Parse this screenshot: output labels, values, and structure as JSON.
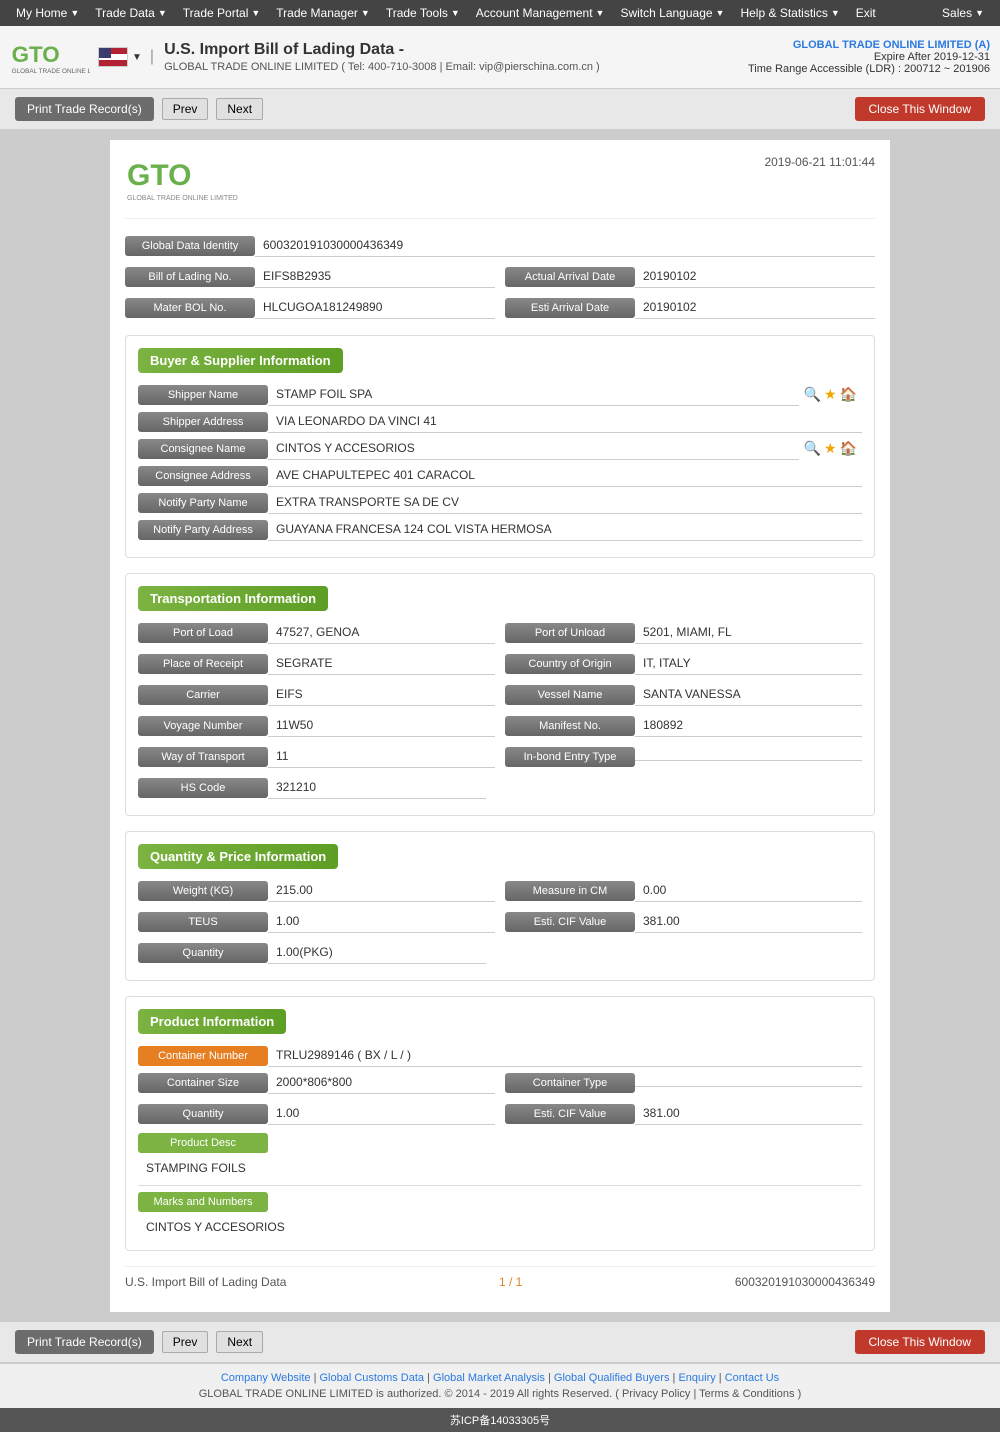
{
  "nav": {
    "items": [
      {
        "label": "My Home",
        "arrow": true
      },
      {
        "label": "Trade Data",
        "arrow": true
      },
      {
        "label": "Trade Portal",
        "arrow": true
      },
      {
        "label": "Trade Manager",
        "arrow": true
      },
      {
        "label": "Trade Tools",
        "arrow": true
      },
      {
        "label": "Account Management",
        "arrow": true
      },
      {
        "label": "Switch Language",
        "arrow": true
      },
      {
        "label": "Help & Statistics",
        "arrow": true
      },
      {
        "label": "Exit",
        "arrow": false
      }
    ],
    "right": "Sales"
  },
  "header": {
    "title": "U.S. Import Bill of Lading Data  -",
    "subtitle": "GLOBAL TRADE ONLINE LIMITED ( Tel: 400-710-3008 | Email: vip@pierschina.com.cn )",
    "company": "GLOBAL TRADE ONLINE LIMITED (A)",
    "expire": "Expire After 2019-12-31",
    "ldr": "Time Range Accessible (LDR) : 200712 ~ 201906"
  },
  "actions": {
    "print_label": "Print Trade Record(s)",
    "prev_label": "Prev",
    "next_label": "Next",
    "close_label": "Close This Window"
  },
  "document": {
    "datetime": "2019-06-21  11:01:44",
    "global_data_identity_label": "Global Data Identity",
    "global_data_identity_value": "600320191030000436349",
    "bill_of_lading_label": "Bill of Lading No.",
    "bill_of_lading_value": "EIFS8B2935",
    "actual_arrival_label": "Actual Arrival Date",
    "actual_arrival_value": "20190102",
    "mater_bol_label": "Mater BOL No.",
    "mater_bol_value": "HLCUGOA181249890",
    "esti_arrival_label": "Esti Arrival Date",
    "esti_arrival_value": "20190102"
  },
  "buyer_supplier": {
    "section_title": "Buyer & Supplier Information",
    "shipper_name_label": "Shipper Name",
    "shipper_name_value": "STAMP FOIL SPA",
    "shipper_address_label": "Shipper Address",
    "shipper_address_value": "VIA LEONARDO DA VINCI 41",
    "consignee_name_label": "Consignee Name",
    "consignee_name_value": "CINTOS Y ACCESORIOS",
    "consignee_address_label": "Consignee Address",
    "consignee_address_value": "AVE CHAPULTEPEC 401 CARACOL",
    "notify_party_name_label": "Notify Party Name",
    "notify_party_name_value": "EXTRA TRANSPORTE SA DE CV",
    "notify_party_address_label": "Notify Party Address",
    "notify_party_address_value": "GUAYANA FRANCESA 124 COL VISTA HERMOSA"
  },
  "transportation": {
    "section_title": "Transportation Information",
    "port_of_load_label": "Port of Load",
    "port_of_load_value": "47527, GENOA",
    "port_of_unload_label": "Port of Unload",
    "port_of_unload_value": "5201, MIAMI, FL",
    "place_of_receipt_label": "Place of Receipt",
    "place_of_receipt_value": "SEGRATE",
    "country_of_origin_label": "Country of Origin",
    "country_of_origin_value": "IT, ITALY",
    "carrier_label": "Carrier",
    "carrier_value": "EIFS",
    "vessel_name_label": "Vessel Name",
    "vessel_name_value": "SANTA VANESSA",
    "voyage_number_label": "Voyage Number",
    "voyage_number_value": "11W50",
    "manifest_no_label": "Manifest No.",
    "manifest_no_value": "180892",
    "way_of_transport_label": "Way of Transport",
    "way_of_transport_value": "11",
    "inbond_entry_label": "In-bond Entry Type",
    "inbond_entry_value": "",
    "hs_code_label": "HS Code",
    "hs_code_value": "321210"
  },
  "quantity_price": {
    "section_title": "Quantity & Price Information",
    "weight_label": "Weight (KG)",
    "weight_value": "215.00",
    "measure_label": "Measure in CM",
    "measure_value": "0.00",
    "teus_label": "TEUS",
    "teus_value": "1.00",
    "esti_cif_label": "Esti. CIF Value",
    "esti_cif_value": "381.00",
    "quantity_label": "Quantity",
    "quantity_value": "1.00(PKG)"
  },
  "product": {
    "section_title": "Product Information",
    "container_number_label": "Container Number",
    "container_number_value": "TRLU2989146 ( BX / L / )",
    "container_size_label": "Container Size",
    "container_size_value": "2000*806*800",
    "container_type_label": "Container Type",
    "container_type_value": "",
    "quantity_label": "Quantity",
    "quantity_value": "1.00",
    "esti_cif_label": "Esti. CIF Value",
    "esti_cif_value": "381.00",
    "product_desc_label": "Product Desc",
    "product_desc_value": "STAMPING FOILS",
    "marks_label": "Marks and Numbers",
    "marks_value": "CINTOS Y ACCESORIOS"
  },
  "footer": {
    "doc_label": "U.S. Import Bill of Lading Data",
    "page_info": "1 / 1",
    "record_id": "600320191030000436349"
  },
  "site_footer": {
    "links": [
      "Company Website",
      "Global Customs Data",
      "Global Market Analysis",
      "Global Qualified Buyers",
      "Enquiry",
      "Contact Us"
    ],
    "copyright": "GLOBAL TRADE ONLINE LIMITED is authorized. © 2014 - 2019 All rights Reserved.  (  Privacy Policy  |  Terms & Conditions  )",
    "icp": "苏ICP备14033305号"
  }
}
